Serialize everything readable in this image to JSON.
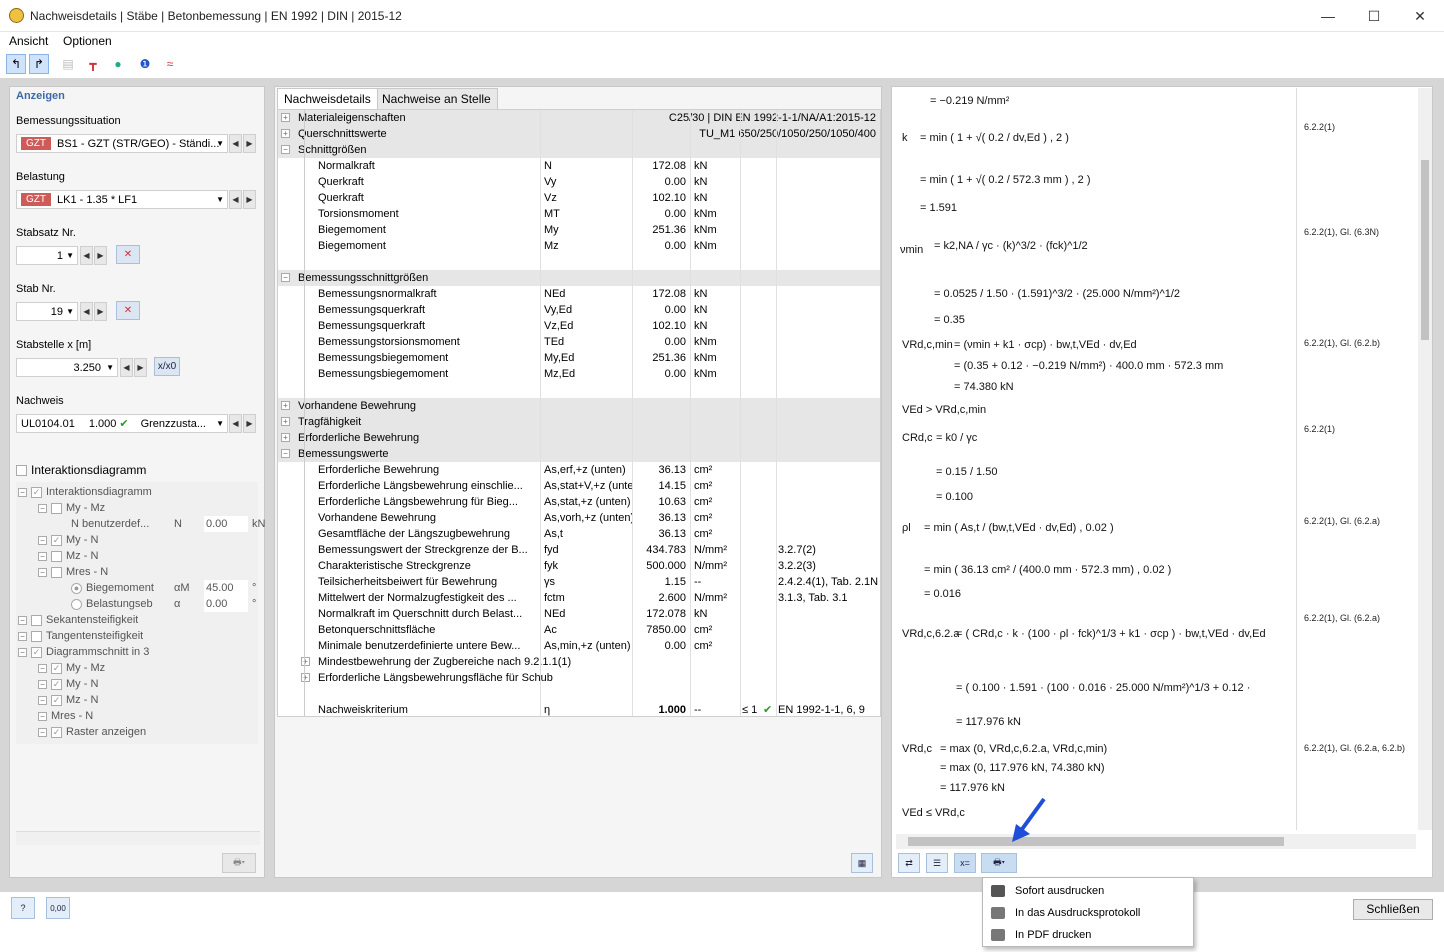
{
  "window": {
    "title": "Nachweisdetails | Stäbe | Betonbemessung | EN 1992 | DIN | 2015-12",
    "min": "—",
    "max": "☐",
    "close": "✕"
  },
  "menu": {
    "ansicht": "Ansicht",
    "optionen": "Optionen"
  },
  "left": {
    "heading": "Anzeigen",
    "situation_label": "Bemessungssituation",
    "situation_tag": "GZT",
    "situation_value": "BS1 - GZT (STR/GEO) - Ständi...",
    "belastung_label": "Belastung",
    "belastung_tag": "GZT",
    "belastung_value": "LK1 - 1.35 * LF1",
    "stabsatz_label": "Stabsatz Nr.",
    "stabsatz_value": "1",
    "stab_label": "Stab Nr.",
    "stab_value": "19",
    "stelle_label": "Stabstelle x [m]",
    "stelle_value": "3.250",
    "stelle_btn": "x/x0",
    "nachweis_label": "Nachweis",
    "nachweis_id": "UL0104.01",
    "nachweis_val": "1.000",
    "nachweis_type": "Grenzzusta...",
    "interaktion_label": "Interaktionsdiagramm",
    "tree": [
      {
        "t": "Interaktionsdiagramm"
      },
      {
        "t": "My - Mz"
      },
      {
        "t": "N benutzerdef...",
        "sym": "N",
        "val": "0.00",
        "unit": "kN"
      },
      {
        "t": "My - N"
      },
      {
        "t": "Mz - N"
      },
      {
        "t": "Mres - N"
      },
      {
        "t": "Biegemoment",
        "sym": "αM",
        "val": "45.00",
        "unit": "°"
      },
      {
        "t": "Belastungseb",
        "sym": "α",
        "val": "0.00",
        "unit": "°"
      },
      {
        "t": "Sekantensteifigkeit"
      },
      {
        "t": "Tangentensteifigkeit"
      },
      {
        "t": "Diagrammschnitt in 3"
      },
      {
        "t": "My - Mz"
      },
      {
        "t": "My - N"
      },
      {
        "t": "Mz - N"
      },
      {
        "t": "Mres - N"
      },
      {
        "t": "Raster anzeigen"
      }
    ]
  },
  "tabs": {
    "details": "Nachweisdetails",
    "stelle": "Nachweise an Stelle"
  },
  "grid": {
    "material": {
      "label": "Materialeigenschaften",
      "value": "C25/30 | DIN EN 1992-1-1/NA/A1:2015-12"
    },
    "querschnitt": {
      "label": "Querschnittswerte",
      "value": "TU_M1 650/250/1050/250/1050/400"
    },
    "schnitt": {
      "label": "Schnittgrößen",
      "rows": [
        [
          "Normalkraft",
          "N",
          "172.08",
          "kN"
        ],
        [
          "Querkraft",
          "Vy",
          "0.00",
          "kN"
        ],
        [
          "Querkraft",
          "Vz",
          "102.10",
          "kN"
        ],
        [
          "Torsionsmoment",
          "MT",
          "0.00",
          "kNm"
        ],
        [
          "Biegemoment",
          "My",
          "251.36",
          "kNm"
        ],
        [
          "Biegemoment",
          "Mz",
          "0.00",
          "kNm"
        ]
      ]
    },
    "bem": {
      "label": "Bemessungsschnittgrößen",
      "rows": [
        [
          "Bemessungsnormalkraft",
          "NEd",
          "172.08",
          "kN"
        ],
        [
          "Bemessungsquerkraft",
          "Vy,Ed",
          "0.00",
          "kN"
        ],
        [
          "Bemessungsquerkraft",
          "Vz,Ed",
          "102.10",
          "kN"
        ],
        [
          "Bemessungstorsionsmoment",
          "TEd",
          "0.00",
          "kNm"
        ],
        [
          "Bemessungsbiegemoment",
          "My,Ed",
          "251.36",
          "kNm"
        ],
        [
          "Bemessungsbiegemoment",
          "Mz,Ed",
          "0.00",
          "kNm"
        ]
      ]
    },
    "vorh": "Vorhandene Bewehrung",
    "trag": "Tragfähigkeit",
    "erf": "Erforderliche Bewehrung",
    "bw": {
      "label": "Bemessungswerte",
      "rows": [
        [
          "Erforderliche Bewehrung",
          "As,erf,+z (unten)",
          "36.13",
          "cm²",
          ""
        ],
        [
          "Erforderliche Längsbewehrung einschlie...",
          "As,stat+V,+z (unten)",
          "14.15",
          "cm²",
          ""
        ],
        [
          "Erforderliche Längsbewehrung für Bieg...",
          "As,stat,+z (unten)",
          "10.63",
          "cm²",
          ""
        ],
        [
          "Vorhandene Bewehrung",
          "As,vorh,+z (unten)",
          "36.13",
          "cm²",
          ""
        ],
        [
          "Gesamtfläche der Längszugbewehrung",
          "As,t",
          "36.13",
          "cm²",
          ""
        ],
        [
          "Bemessungswert der Streckgrenze der B...",
          "fyd",
          "434.783",
          "N/mm²",
          "3.2.7(2)"
        ],
        [
          "Charakteristische Streckgrenze",
          "fyk",
          "500.000",
          "N/mm²",
          "3.2.2(3)"
        ],
        [
          "Teilsicherheitsbeiwert für Bewehrung",
          "γs",
          "1.15",
          "--",
          "2.4.2.4(1), Tab. 2.1N"
        ],
        [
          "Mittelwert der Normalzugfestigkeit des ...",
          "fctm",
          "2.600",
          "N/mm²",
          "3.1.3, Tab. 3.1"
        ],
        [
          "Normalkraft im Querschnitt durch Belast...",
          "NEd",
          "172.078",
          "kN",
          ""
        ],
        [
          "Betonquerschnittsfläche",
          "Ac",
          "7850.00",
          "cm²",
          ""
        ],
        [
          "Minimale benutzerdefinierte untere Bew...",
          "As,min,+z (unten)",
          "0.00",
          "cm²",
          ""
        ]
      ]
    },
    "mindest": "Mindestbewehrung der Zugbereiche nach 9.2.1.1(1)",
    "schub": "Erforderliche Längsbewehrungsfläche für Schub",
    "krit": {
      "label": "Nachweiskriterium",
      "sym": "η",
      "val": "1.000",
      "unit": "--",
      "limit": "≤ 1",
      "ref": "EN 1992-1-1, 6, 9"
    }
  },
  "formulas": {
    "l1": "=   −0.219 N/mm²",
    "k_lbl": "k",
    "k1": "=   min ( 1 + √( 0.2 / dv,Ed ) , 2 )",
    "k2": "=   min ( 1 + √( 0.2 / 572.3 mm ) , 2 )",
    "k3": "=   1.591",
    "k_ref": "6.2.2(1)",
    "v_lbl": "νmin",
    "v1": "=   k2,NA / γc · (k)^3/2 · (fck)^1/2",
    "v2": "=   0.0525 / 1.50 · (1.591)^3/2 · (25.000 N/mm²)^1/2",
    "v3": "=   0.35",
    "v_ref": "6.2.2(1), Gl. (6.3N)",
    "vr_lbl": "VRd,c,min",
    "vr1": "=   (νmin + k1 · σcp) · bw,t,VEd · dv,Ed",
    "vr2": "=   (0.35 + 0.12 · −0.219 N/mm²) · 400.0 mm · 572.3 mm",
    "vr3": "=   74.380 kN",
    "vr_ref": "6.2.2(1), Gl. (6.2.b)",
    "cmp": "VEd > VRd,c,min",
    "c_lbl": "CRd,c",
    "c1": "=   k0 / γc",
    "c2": "=   0.15 / 1.50",
    "c3": "=   0.100",
    "c_ref": "6.2.2(1)",
    "r_lbl": "ρl",
    "r1": "=   min ( As,t / (bw,t,VEd · dv,Ed) , 0.02 )",
    "r2": "=   min ( 36.13 cm² / (400.0 mm · 572.3 mm) , 0.02 )",
    "r3": "=   0.016",
    "r_ref": "6.2.2(1), Gl. (6.2.a)",
    "va_lbl": "VRd,c,6.2.a",
    "va1": "=   ( CRd,c · k · (100 · ρl · fck)^1/3 + k1 · σcp ) · bw,t,VEd · dv,Ed",
    "va2": "=   ( 0.100 · 1.591 · (100 · 0.016 · 25.000 N/mm²)^1/3 + 0.12 ·",
    "va3": "=   117.976 kN",
    "va_ref": "6.2.2(1), Gl. (6.2.a)",
    "vc_lbl": "VRd,c",
    "vc1": "=   max (0, VRd,c,6.2.a, VRd,c,min)",
    "vc2": "=   max (0, 117.976 kN, 74.380 kN)",
    "vc3": "=   117.976 kN",
    "vc_ref": "6.2.2(1), Gl. (6.2.a, 6.2.b)",
    "final": "VEd ≤ VRd,c"
  },
  "printmenu": {
    "sofort": "Sofort ausdrucken",
    "protokoll": "In das Ausdrucksprotokoll",
    "pdf": "In PDF drucken"
  },
  "close_button": "Schließen",
  "icons": {
    "accent": "#0a58c4",
    "gzt": "#cf5a5a"
  }
}
